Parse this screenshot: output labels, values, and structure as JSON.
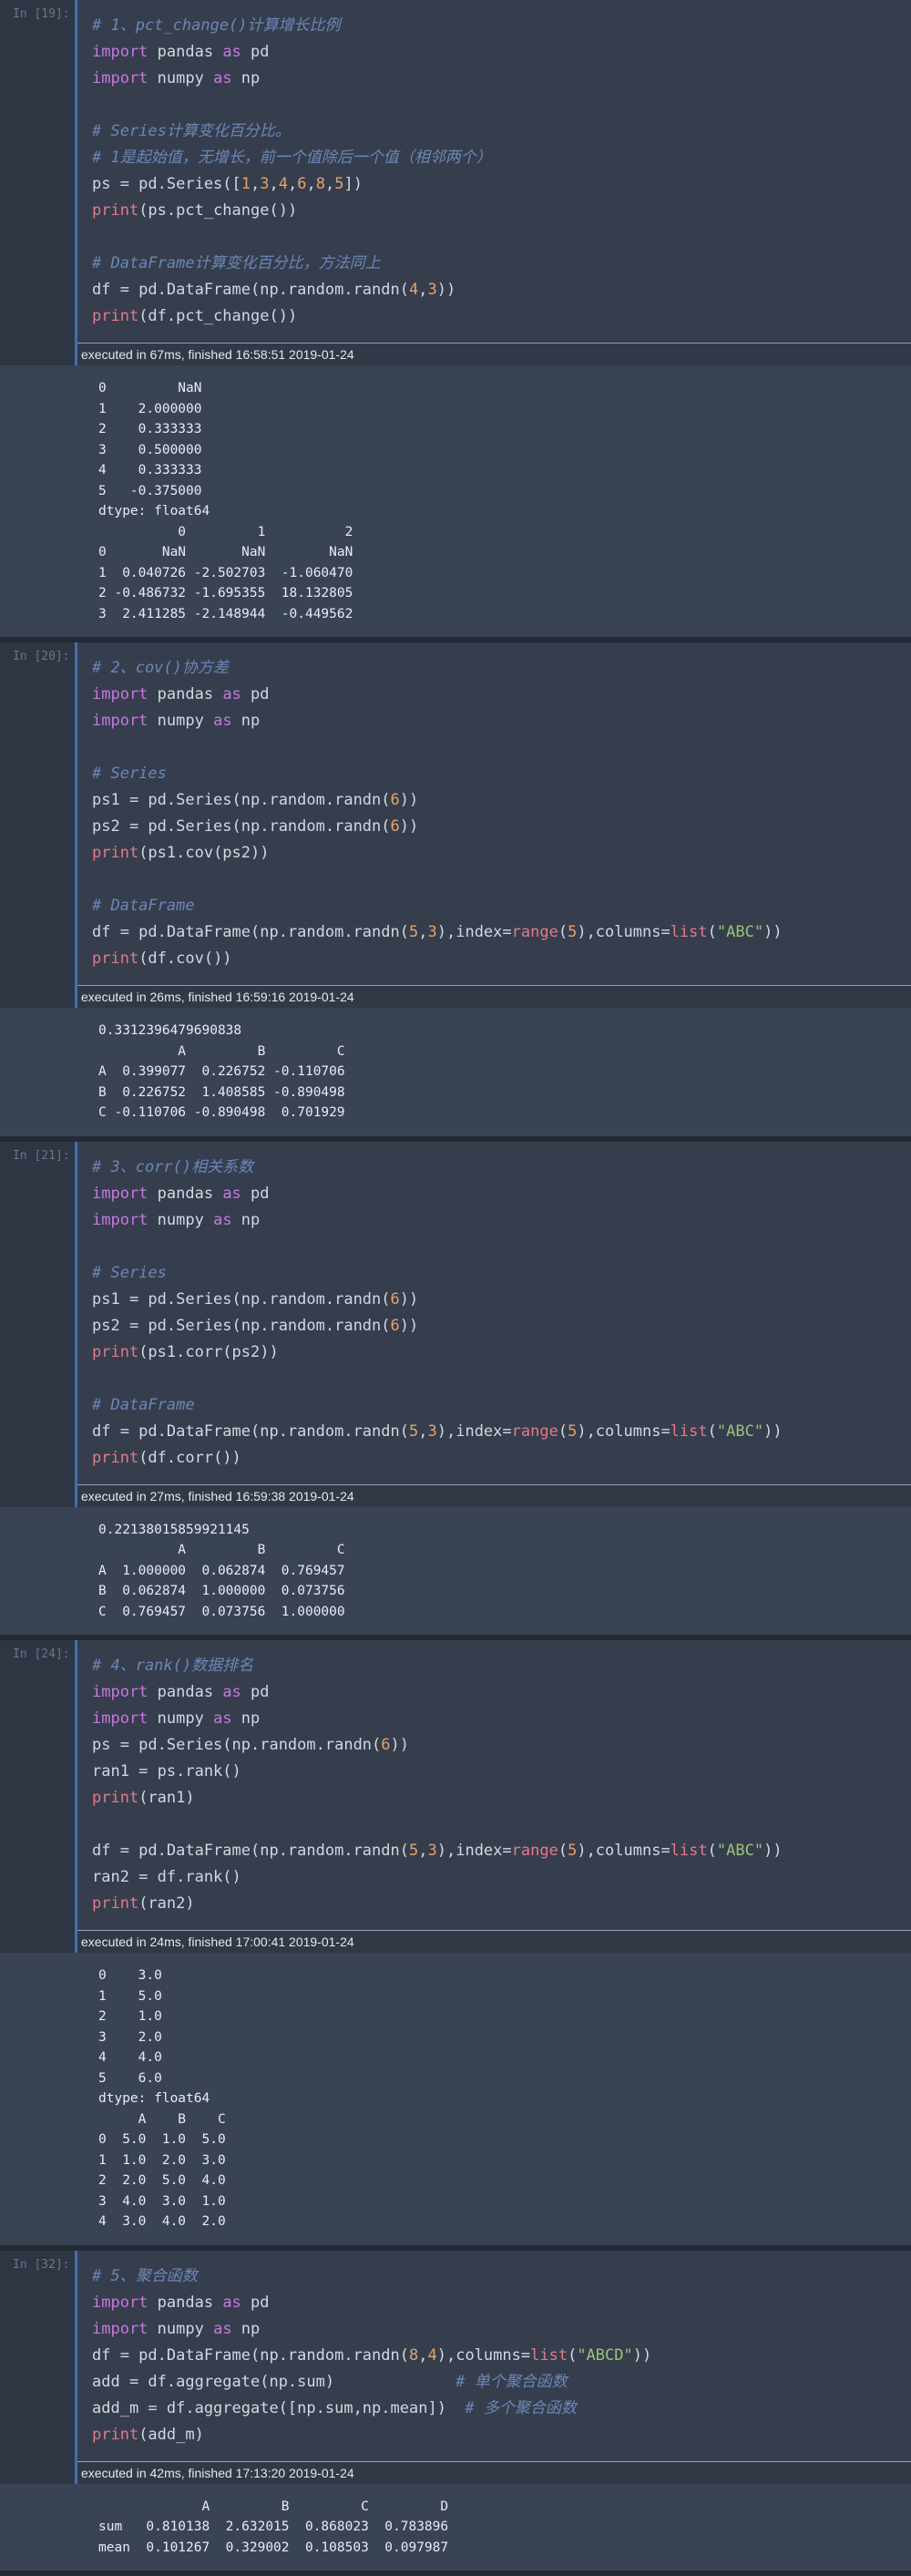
{
  "colors": {
    "keyword": "#c678dd",
    "comment": "#6c86b8",
    "number": "#e5a26b",
    "string": "#98c379",
    "builtin": "#e07a8a",
    "text": "#d2d8e2",
    "cell_border_accent": "#3f6fb3"
  },
  "cells": [
    {
      "prompt": "In [19]:",
      "code": [
        [
          [
            "cm",
            "# 1、pct_change()计算增长比例"
          ]
        ],
        [
          [
            "kw",
            "import"
          ],
          [
            "tx",
            " pandas "
          ],
          [
            "kw",
            "as"
          ],
          [
            "tx",
            " pd"
          ]
        ],
        [
          [
            "kw",
            "import"
          ],
          [
            "tx",
            " numpy "
          ],
          [
            "kw",
            "as"
          ],
          [
            "tx",
            " np"
          ]
        ],
        [],
        [
          [
            "cm",
            "# Series计算变化百分比。"
          ]
        ],
        [
          [
            "cm",
            "# 1是起始值，无增长，前一个值除后一个值（相邻两个）"
          ]
        ],
        [
          [
            "tx",
            "ps = pd.Series(["
          ],
          [
            "num",
            "1"
          ],
          [
            "tx",
            ","
          ],
          [
            "num",
            "3"
          ],
          [
            "tx",
            ","
          ],
          [
            "num",
            "4"
          ],
          [
            "tx",
            ","
          ],
          [
            "num",
            "6"
          ],
          [
            "tx",
            ","
          ],
          [
            "num",
            "8"
          ],
          [
            "tx",
            ","
          ],
          [
            "num",
            "5"
          ],
          [
            "tx",
            "])"
          ]
        ],
        [
          [
            "fn",
            "print"
          ],
          [
            "tx",
            "(ps.pct_change())"
          ]
        ],
        [],
        [
          [
            "cm",
            "# DataFrame计算变化百分比，方法同上"
          ]
        ],
        [
          [
            "tx",
            "df = pd.DataFrame(np.random.randn("
          ],
          [
            "num",
            "4"
          ],
          [
            "tx",
            ","
          ],
          [
            "num",
            "3"
          ],
          [
            "tx",
            "))"
          ]
        ],
        [
          [
            "fn",
            "print"
          ],
          [
            "tx",
            "(df.pct_change())"
          ]
        ]
      ],
      "exec": "executed in 67ms, finished 16:58:51 2019-01-24",
      "output": [
        "0         NaN",
        "1    2.000000",
        "2    0.333333",
        "3    0.500000",
        "4    0.333333",
        "5   -0.375000",
        "dtype: float64",
        "          0         1          2",
        "0       NaN       NaN        NaN",
        "1  0.040726 -2.502703  -1.060470",
        "2 -0.486732 -1.695355  18.132805",
        "3  2.411285 -2.148944  -0.449562"
      ]
    },
    {
      "prompt": "In [20]:",
      "code": [
        [
          [
            "cm",
            "# 2、cov()协方差"
          ]
        ],
        [
          [
            "kw",
            "import"
          ],
          [
            "tx",
            " pandas "
          ],
          [
            "kw",
            "as"
          ],
          [
            "tx",
            " pd"
          ]
        ],
        [
          [
            "kw",
            "import"
          ],
          [
            "tx",
            " numpy "
          ],
          [
            "kw",
            "as"
          ],
          [
            "tx",
            " np"
          ]
        ],
        [],
        [
          [
            "cm",
            "# Series"
          ]
        ],
        [
          [
            "tx",
            "ps1 = pd.Series(np.random.randn("
          ],
          [
            "num",
            "6"
          ],
          [
            "tx",
            "))"
          ]
        ],
        [
          [
            "tx",
            "ps2 = pd.Series(np.random.randn("
          ],
          [
            "num",
            "6"
          ],
          [
            "tx",
            "))"
          ]
        ],
        [
          [
            "fn",
            "print"
          ],
          [
            "tx",
            "(ps1.cov(ps2))"
          ]
        ],
        [],
        [
          [
            "cm",
            "# DataFrame"
          ]
        ],
        [
          [
            "tx",
            "df = pd.DataFrame(np.random.randn("
          ],
          [
            "num",
            "5"
          ],
          [
            "tx",
            ","
          ],
          [
            "num",
            "3"
          ],
          [
            "tx",
            "),index="
          ],
          [
            "fn",
            "range"
          ],
          [
            "tx",
            "("
          ],
          [
            "num",
            "5"
          ],
          [
            "tx",
            "),columns="
          ],
          [
            "fn",
            "list"
          ],
          [
            "tx",
            "("
          ],
          [
            "str",
            "\"ABC\""
          ],
          [
            "tx",
            "))"
          ]
        ],
        [
          [
            "fn",
            "print"
          ],
          [
            "tx",
            "(df.cov())"
          ]
        ]
      ],
      "exec": "executed in 26ms, finished 16:59:16 2019-01-24",
      "output": [
        "0.3312396479690838",
        "          A         B         C",
        "A  0.399077  0.226752 -0.110706",
        "B  0.226752  1.408585 -0.890498",
        "C -0.110706 -0.890498  0.701929"
      ]
    },
    {
      "prompt": "In [21]:",
      "code": [
        [
          [
            "cm",
            "# 3、corr()相关系数"
          ]
        ],
        [
          [
            "kw",
            "import"
          ],
          [
            "tx",
            " pandas "
          ],
          [
            "kw",
            "as"
          ],
          [
            "tx",
            " pd"
          ]
        ],
        [
          [
            "kw",
            "import"
          ],
          [
            "tx",
            " numpy "
          ],
          [
            "kw",
            "as"
          ],
          [
            "tx",
            " np"
          ]
        ],
        [],
        [
          [
            "cm",
            "# Series"
          ]
        ],
        [
          [
            "tx",
            "ps1 = pd.Series(np.random.randn("
          ],
          [
            "num",
            "6"
          ],
          [
            "tx",
            "))"
          ]
        ],
        [
          [
            "tx",
            "ps2 = pd.Series(np.random.randn("
          ],
          [
            "num",
            "6"
          ],
          [
            "tx",
            "))"
          ]
        ],
        [
          [
            "fn",
            "print"
          ],
          [
            "tx",
            "(ps1.corr(ps2))"
          ]
        ],
        [],
        [
          [
            "cm",
            "# DataFrame"
          ]
        ],
        [
          [
            "tx",
            "df = pd.DataFrame(np.random.randn("
          ],
          [
            "num",
            "5"
          ],
          [
            "tx",
            ","
          ],
          [
            "num",
            "3"
          ],
          [
            "tx",
            "),index="
          ],
          [
            "fn",
            "range"
          ],
          [
            "tx",
            "("
          ],
          [
            "num",
            "5"
          ],
          [
            "tx",
            "),columns="
          ],
          [
            "fn",
            "list"
          ],
          [
            "tx",
            "("
          ],
          [
            "str",
            "\"ABC\""
          ],
          [
            "tx",
            "))"
          ]
        ],
        [
          [
            "fn",
            "print"
          ],
          [
            "tx",
            "(df.corr())"
          ]
        ]
      ],
      "exec": "executed in 27ms, finished 16:59:38 2019-01-24",
      "output": [
        "0.22138015859921145",
        "          A         B         C",
        "A  1.000000  0.062874  0.769457",
        "B  0.062874  1.000000  0.073756",
        "C  0.769457  0.073756  1.000000"
      ]
    },
    {
      "prompt": "In [24]:",
      "code": [
        [
          [
            "cm",
            "# 4、rank()数据排名"
          ]
        ],
        [
          [
            "kw",
            "import"
          ],
          [
            "tx",
            " pandas "
          ],
          [
            "kw",
            "as"
          ],
          [
            "tx",
            " pd"
          ]
        ],
        [
          [
            "kw",
            "import"
          ],
          [
            "tx",
            " numpy "
          ],
          [
            "kw",
            "as"
          ],
          [
            "tx",
            " np"
          ]
        ],
        [
          [
            "tx",
            "ps = pd.Series(np.random.randn("
          ],
          [
            "num",
            "6"
          ],
          [
            "tx",
            "))"
          ]
        ],
        [
          [
            "tx",
            "ran1 = ps.rank()"
          ]
        ],
        [
          [
            "fn",
            "print"
          ],
          [
            "tx",
            "(ran1)"
          ]
        ],
        [],
        [
          [
            "tx",
            "df = pd.DataFrame(np.random.randn("
          ],
          [
            "num",
            "5"
          ],
          [
            "tx",
            ","
          ],
          [
            "num",
            "3"
          ],
          [
            "tx",
            "),index="
          ],
          [
            "fn",
            "range"
          ],
          [
            "tx",
            "("
          ],
          [
            "num",
            "5"
          ],
          [
            "tx",
            "),columns="
          ],
          [
            "fn",
            "list"
          ],
          [
            "tx",
            "("
          ],
          [
            "str",
            "\"ABC\""
          ],
          [
            "tx",
            "))"
          ]
        ],
        [
          [
            "tx",
            "ran2 = df.rank()"
          ]
        ],
        [
          [
            "fn",
            "print"
          ],
          [
            "tx",
            "(ran2)"
          ]
        ]
      ],
      "exec": "executed in 24ms, finished 17:00:41 2019-01-24",
      "output": [
        "0    3.0",
        "1    5.0",
        "2    1.0",
        "3    2.0",
        "4    4.0",
        "5    6.0",
        "dtype: float64",
        "     A    B    C",
        "0  5.0  1.0  5.0",
        "1  1.0  2.0  3.0",
        "2  2.0  5.0  4.0",
        "3  4.0  3.0  1.0",
        "4  3.0  4.0  2.0"
      ]
    },
    {
      "prompt": "In [32]:",
      "code": [
        [
          [
            "cm",
            "# 5、聚合函数"
          ]
        ],
        [
          [
            "kw",
            "import"
          ],
          [
            "tx",
            " pandas "
          ],
          [
            "kw",
            "as"
          ],
          [
            "tx",
            " pd"
          ]
        ],
        [
          [
            "kw",
            "import"
          ],
          [
            "tx",
            " numpy "
          ],
          [
            "kw",
            "as"
          ],
          [
            "tx",
            " np"
          ]
        ],
        [
          [
            "tx",
            "df = pd.DataFrame(np.random.randn("
          ],
          [
            "num",
            "8"
          ],
          [
            "tx",
            ","
          ],
          [
            "num",
            "4"
          ],
          [
            "tx",
            "),columns="
          ],
          [
            "fn",
            "list"
          ],
          [
            "tx",
            "("
          ],
          [
            "str",
            "\"ABCD\""
          ],
          [
            "tx",
            "))"
          ]
        ],
        [
          [
            "tx",
            "add = df.aggregate(np.sum)             "
          ],
          [
            "cm",
            "# 单个聚合函数"
          ]
        ],
        [
          [
            "tx",
            "add_m = df.aggregate([np.sum,np.mean])  "
          ],
          [
            "cm",
            "# 多个聚合函数"
          ]
        ],
        [
          [
            "fn",
            "print"
          ],
          [
            "tx",
            "(add_m)"
          ]
        ]
      ],
      "exec": "executed in 42ms, finished 17:13:20 2019-01-24",
      "output": [
        "             A         B         C         D",
        "sum   0.810138  2.632015  0.868023  0.783896",
        "mean  0.101267  0.329002  0.108503  0.097987"
      ]
    }
  ]
}
